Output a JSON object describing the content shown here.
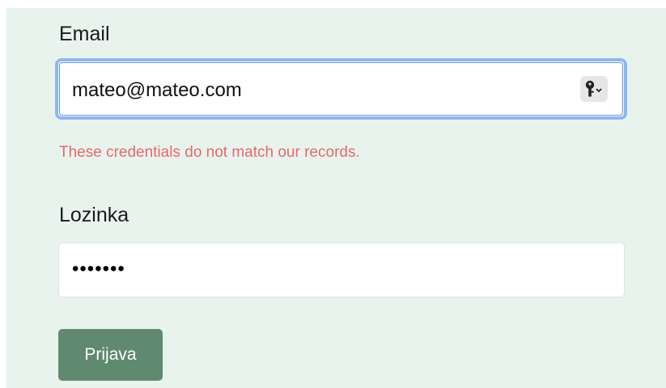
{
  "form": {
    "email_label": "Email",
    "email_value": "mateo@mateo.com",
    "error_message": "These credentials do not match our records.",
    "password_label": "Lozinka",
    "password_value": "•••••••",
    "submit_label": "Prijava"
  },
  "icons": {
    "password_manager": "key-icon"
  },
  "colors": {
    "background": "#e9f3ee",
    "focus_border": "#8fb6ee",
    "error": "#e56a6a",
    "button": "#5f8a70"
  }
}
